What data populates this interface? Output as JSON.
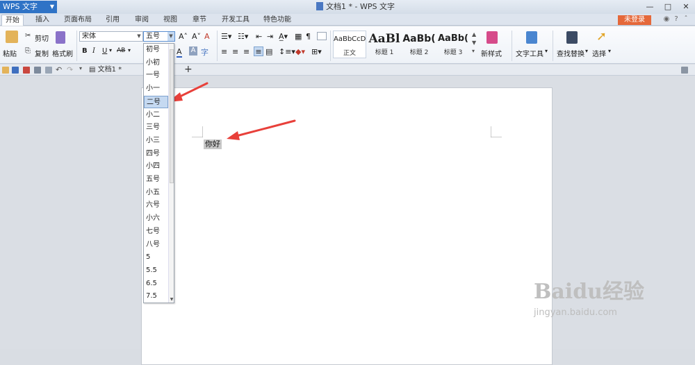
{
  "titlebar": {
    "app_menu": "WPS 文字",
    "doc_title": "文档1 * - WPS 文字"
  },
  "tabs": [
    {
      "label": "开始"
    },
    {
      "label": "插入"
    },
    {
      "label": "页面布局"
    },
    {
      "label": "引用"
    },
    {
      "label": "审阅"
    },
    {
      "label": "视图"
    },
    {
      "label": "章节"
    },
    {
      "label": "开发工具"
    },
    {
      "label": "特色功能"
    }
  ],
  "login_label": "未登录",
  "ribbon": {
    "paste": "粘贴",
    "cut": "剪切",
    "copy": "复制",
    "format_painter": "格式刷",
    "font_name": "宋体",
    "font_size": "五号",
    "bold": "B",
    "italic": "I",
    "underline": "U",
    "strike": "AB",
    "styles": [
      {
        "preview": "AaBbCcDd",
        "label": "正文"
      },
      {
        "preview": "AaBl",
        "label": "标题 1"
      },
      {
        "preview": "AaBb(",
        "label": "标题 2"
      },
      {
        "preview": "AaBb(",
        "label": "标题 3"
      }
    ],
    "new_style": "新样式",
    "text_tools": "文字工具",
    "find_replace": "查找替换",
    "select": "选择"
  },
  "quickbar": {
    "doc_tab": "文档1 *"
  },
  "document": {
    "selected_text": "你好"
  },
  "font_size_dropdown": {
    "items": [
      "初号",
      "小初",
      "一号",
      "小一",
      "二号",
      "小二",
      "三号",
      "小三",
      "四号",
      "小四",
      "五号",
      "小五",
      "六号",
      "小六",
      "七号",
      "八号",
      "5",
      "5.5",
      "6.5",
      "7.5"
    ],
    "highlighted": "二号"
  },
  "watermark": {
    "brand": "Baidu经验",
    "url": "jingyan.baidu.com"
  },
  "colors": {
    "accent_blue": "#2f73c6",
    "login_orange": "#e5683a",
    "arrow_red": "#e8403a",
    "highlight": "#c5d9f1"
  }
}
